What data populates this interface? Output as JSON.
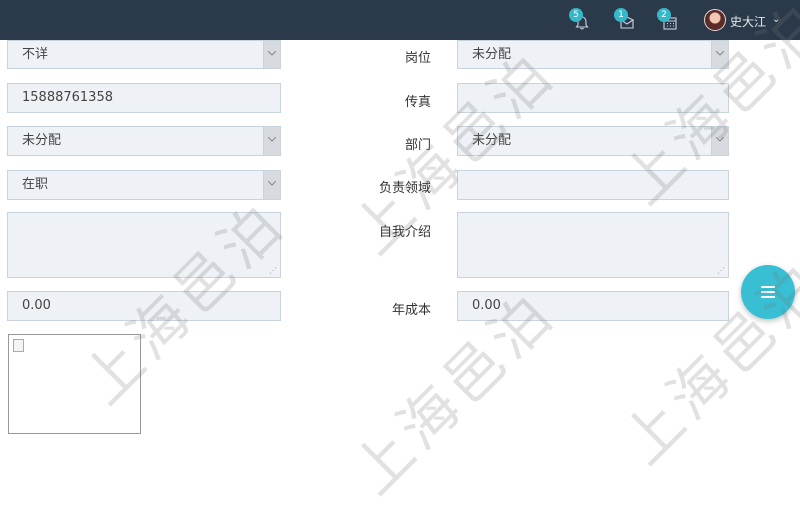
{
  "topbar": {
    "notifications": {
      "icon": "bell-icon",
      "count": "5"
    },
    "messages": {
      "icon": "envelope-icon",
      "count": "1"
    },
    "calendar": {
      "icon": "calendar-icon",
      "count": "2"
    },
    "user": {
      "name": "史大江",
      "avatar": "avatar"
    }
  },
  "form": {
    "row1": {
      "left_value": "不详",
      "right_label": "岗位",
      "right_value": "未分配"
    },
    "row2": {
      "left_value": "15888761358",
      "right_label": "传真",
      "right_value": ""
    },
    "row3": {
      "left_value": "未分配",
      "right_label": "部门",
      "right_value": "未分配"
    },
    "row4": {
      "left_value": "在职",
      "right_label": "负责领域",
      "right_value": ""
    },
    "row5": {
      "left_value": "",
      "right_label": "自我介绍",
      "right_value": ""
    },
    "row6": {
      "left_value": "0.00",
      "right_label": "年成本",
      "right_value": "0.00"
    }
  },
  "watermark": {
    "text": "上海邑泊"
  },
  "colors": {
    "topbar": "#2b3a4a",
    "badge": "#35b8c9",
    "fab": "#38bfd3",
    "field_bg": "#eef1f5"
  }
}
